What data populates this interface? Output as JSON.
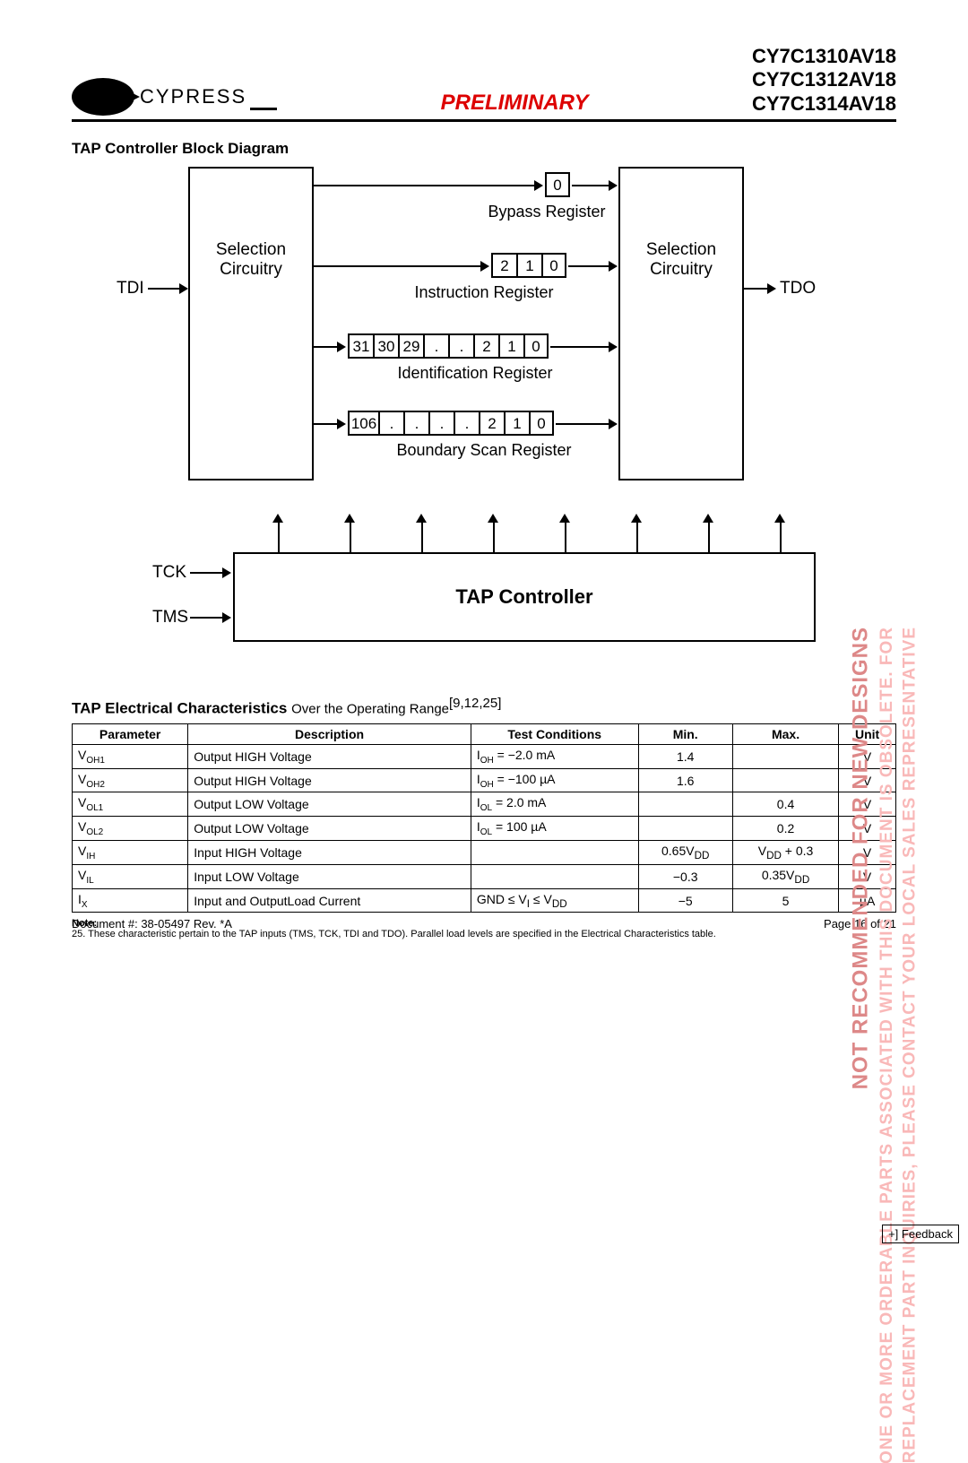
{
  "header": {
    "logo_text": "CYPRESS",
    "preliminary": "PRELIMINARY",
    "parts": [
      "CY7C1310AV18",
      "CY7C1312AV18",
      "CY7C1314AV18"
    ]
  },
  "diagram": {
    "title": "TAP Controller Block Diagram",
    "tdi": "TDI",
    "tdo": "TDO",
    "selection_left": "Selection\nCircuitry",
    "selection_right": "Selection\nCircuitry",
    "bypass_label": "Bypass Register",
    "bypass_cells": [
      "0"
    ],
    "instruction_label": "Instruction Register",
    "instruction_cells": [
      "2",
      "1",
      "0"
    ],
    "identification_label": "Identification Register",
    "identification_cells": [
      "31",
      "30",
      "29",
      ".",
      ".",
      "2",
      "1",
      "0"
    ],
    "boundary_label": "Boundary Scan Register",
    "boundary_cells": [
      "106",
      ".",
      ".",
      ".",
      ".",
      "2",
      "1",
      "0"
    ],
    "tap_controller": "TAP Controller",
    "tck": "TCK",
    "tms": "TMS"
  },
  "table": {
    "title": "TAP Electrical Characteristics",
    "subtitle": "Over the Operating Range",
    "refs": "[9,12,25]",
    "headers": [
      "Parameter",
      "Description",
      "Test Conditions",
      "Min.",
      "Max.",
      "Unit"
    ],
    "rows": [
      {
        "param": "V",
        "psub": "OH1",
        "desc": "Output HIGH Voltage",
        "cond_pre": "I",
        "cond_sub": "OH",
        "cond_post": " = −2.0 mA",
        "min": "1.4",
        "max": "",
        "unit": "V"
      },
      {
        "param": "V",
        "psub": "OH2",
        "desc": "Output HIGH Voltage",
        "cond_pre": "I",
        "cond_sub": "OH",
        "cond_post": " = −100 µA",
        "min": "1.6",
        "max": "",
        "unit": "V"
      },
      {
        "param": "V",
        "psub": "OL1",
        "desc": "Output LOW Voltage",
        "cond_pre": "I",
        "cond_sub": "OL",
        "cond_post": " = 2.0 mA",
        "min": "",
        "max": "0.4",
        "unit": "V"
      },
      {
        "param": "V",
        "psub": "OL2",
        "desc": "Output LOW Voltage",
        "cond_pre": "I",
        "cond_sub": "OL",
        "cond_post": " = 100 µA",
        "min": "",
        "max": "0.2",
        "unit": "V"
      },
      {
        "param": "V",
        "psub": "IH",
        "desc": "Input HIGH Voltage",
        "cond_raw": "",
        "min_html": "0.65V<sub>DD</sub>",
        "max_html": "V<sub>DD</sub> + 0.3",
        "unit": "V"
      },
      {
        "param": "V",
        "psub": "IL",
        "desc": "Input LOW Voltage",
        "cond_raw": "",
        "min": "−0.3",
        "max_html": "0.35V<sub>DD</sub>",
        "unit": "V"
      },
      {
        "param": "I",
        "psub": "X",
        "desc": "Input and OutputLoad Current",
        "cond_html": "GND ≤ V<sub>I</sub> ≤ V<sub>DD</sub>",
        "min": "−5",
        "max": "5",
        "unit": "µA"
      }
    ]
  },
  "note": {
    "label": "Note:",
    "text": "25. These characteristic pertain to the TAP inputs (TMS, TCK, TDI and TDO). Parallel load levels are specified in the Electrical Characteristics table."
  },
  "footer": {
    "doc": "Document #: 38-05497 Rev. *A",
    "page": "Page 16 of 21"
  },
  "watermarks": {
    "w1": "NOT RECOMMENDED FOR NEW DESIGNS",
    "w2": "ONE OR MORE ORDERABLE PARTS ASSOCIATED WITH THIS DOCUMENT IS OBSOLETE. FOR",
    "w3": "REPLACEMENT PART INQUIRIES, PLEASE CONTACT YOUR LOCAL SALES REPRESENTATIVE"
  },
  "feedback": "+] Feedback"
}
